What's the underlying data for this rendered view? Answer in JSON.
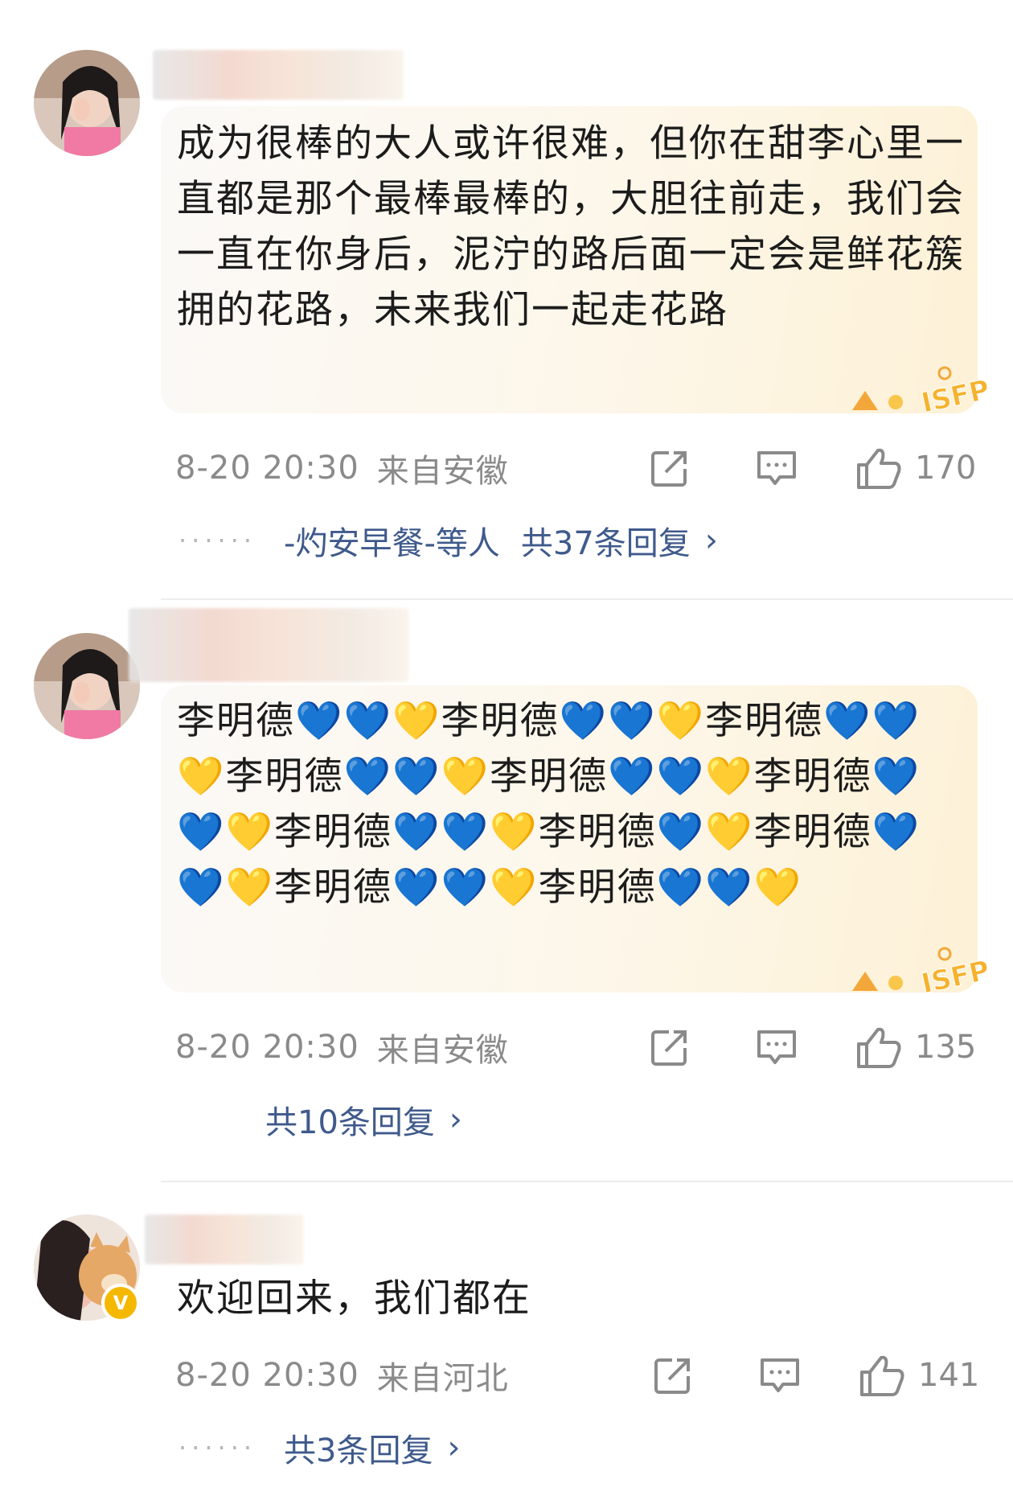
{
  "comments": [
    {
      "text": "成为很棒的大人或许很难，但你在甜李心里一直都是那个最棒最棒的，大胆往前走，我们会一直在你身后，泥泞的路后面一定会是鲜花簇拥的花路，未来我们一起走花路",
      "time": "8-20 20:30",
      "location": "来自安徽",
      "likes": "170",
      "reply_names": "-灼安早餐-等人",
      "reply_count": "共37条回复",
      "badge": "ISFP"
    },
    {
      "text": "李明德💙💙💛李明德💙💙💛李明德💙💙💛李明德💙💙💛李明德💙💙💛李明德💙💙💛李明德💙💙💛李明德💙💛李明德💙💙💛李明德💙💙💛李明德💙💙💛",
      "time": "8-20 20:30",
      "location": "来自安徽",
      "likes": "135",
      "reply_count": "共10条回复",
      "badge": "ISFP"
    },
    {
      "text": "欢迎回来，我们都在",
      "time": "8-20 20:30",
      "location": "来自河北",
      "likes": "141",
      "reply_count": "共3条回复",
      "verified_mark": "V"
    }
  ],
  "icons": {
    "share": "share-icon",
    "comment": "comment-icon",
    "like": "thumbs-up-icon",
    "chevron": "chevron-right-icon"
  },
  "colors": {
    "link": "#3f5a8c",
    "meta": "#8a8a8a",
    "bubble": "#fdf5e4",
    "verified": "#f5b800"
  }
}
